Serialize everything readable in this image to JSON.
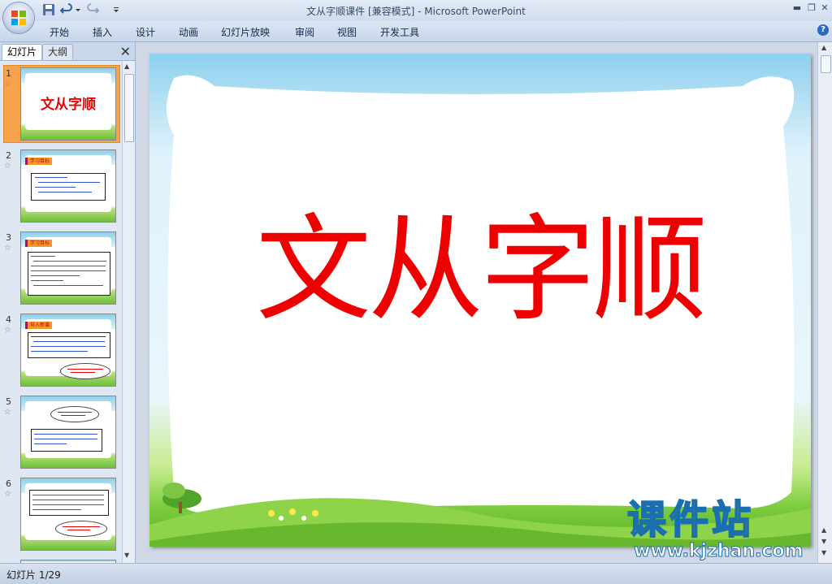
{
  "window": {
    "title": "文从字顺课件 [兼容模式] - Microsoft PowerPoint",
    "minimize": "▬",
    "maximize": "❐",
    "close": "✕"
  },
  "ribbon": {
    "tabs": [
      "开始",
      "插入",
      "设计",
      "动画",
      "幻灯片放映",
      "审阅",
      "视图",
      "开发工具"
    ],
    "help_label": "?"
  },
  "left_pane": {
    "tabs": [
      "幻灯片",
      "大纲"
    ],
    "close_label": "✕",
    "thumbnails": [
      {
        "num": "1",
        "title": "文从字顺",
        "selected": true
      },
      {
        "num": "2",
        "badge": "学习目标"
      },
      {
        "num": "3",
        "badge": "学习目标"
      },
      {
        "num": "4",
        "badge": "导入新课"
      },
      {
        "num": "5"
      },
      {
        "num": "6"
      }
    ]
  },
  "slide": {
    "title": "文从字顺"
  },
  "status": {
    "text": "幻灯片 1/29"
  },
  "watermark": {
    "brand": "课件站",
    "url": "www.kjzhan.com"
  }
}
